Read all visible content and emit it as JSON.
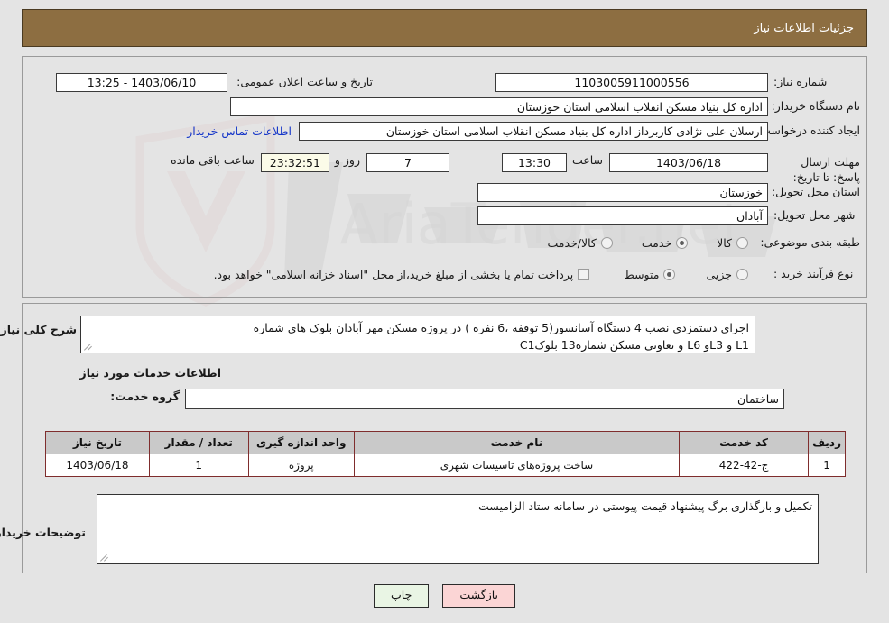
{
  "header": {
    "title": "جزئیات اطلاعات نیاز"
  },
  "colors": {
    "header_bar": "#8d6e41",
    "page_bg": "#e4e4e4",
    "link": "#1435c8",
    "table_header": "#c9c9c9",
    "table_border": "#7f2d2d",
    "print_button": "#e9f5e4",
    "back_button": "#fbd5d5",
    "countdown_field": "#fbfbe8"
  },
  "form": {
    "need_number": {
      "label": "شماره نیاز:",
      "value": "1103005911000556"
    },
    "public_announcement": {
      "label": "تاریخ و ساعت اعلان عمومی:",
      "value": "1403/06/10 - 13:25"
    },
    "buyer_org": {
      "label": "نام دستگاه خریدار:",
      "value": "اداره کل بنیاد مسکن انقلاب اسلامی استان خوزستان"
    },
    "requester": {
      "label": "ایجاد کننده درخواست:",
      "value": "ارسلان علی نژادی کاربرداز اداره کل بنیاد مسکن انقلاب اسلامی استان خوزستان",
      "contact_link": "اطلاعات تماس خریدار"
    },
    "deadline": {
      "label": "مهلت ارسال پاسخ: تا تاریخ:",
      "date": "1403/06/18",
      "time_label": "ساعت",
      "time": "13:30",
      "days": "7",
      "days_label": "روز و",
      "remaining": "23:32:51",
      "remaining_label": "ساعت باقی مانده"
    },
    "delivery_province": {
      "label": "استان محل تحویل:",
      "value": "خوزستان"
    },
    "delivery_city": {
      "label": "شهر محل تحویل:",
      "value": "آبادان"
    },
    "classification": {
      "label": "طبقه بندی موضوعی:",
      "options": [
        {
          "text": "کالا",
          "selected": false
        },
        {
          "text": "خدمت",
          "selected": true
        },
        {
          "text": "کالا/خدمت",
          "selected": false
        }
      ]
    },
    "purchase_type": {
      "label": "نوع فرآیند خرید :",
      "options": [
        {
          "text": "جزیی",
          "selected": false
        },
        {
          "text": "متوسط",
          "selected": true
        }
      ],
      "treasury_note": "پرداخت تمام یا بخشی از مبلغ خرید،از محل \"اسناد خزانه اسلامی\" خواهد بود."
    }
  },
  "need_summary": {
    "label": "شرح کلی نیاز:",
    "line1": "اجرای دستمزدی نصب 4 دستگاه  آسانسور(5 توقفه ،6 نفره ) در  پروژه  مسکن مهر آبادان بلوک های شماره",
    "line2": "L1 و L3و L6 و تعاونی مسکن شماره13 بلوکC1"
  },
  "services_section": {
    "heading": "اطلاعات خدمات مورد نیاز",
    "service_group": {
      "label": "گروه خدمت:",
      "value": "ساختمان"
    }
  },
  "table": {
    "columns": [
      "ردیف",
      "کد خدمت",
      "نام خدمت",
      "واحد اندازه گیری",
      "تعداد / مقدار",
      "تاریخ نیاز"
    ],
    "rows": [
      {
        "radif": "1",
        "code": "ج-42-422",
        "name": "ساخت پروژه‌های تاسیسات شهری",
        "unit": "پروژه",
        "quantity": "1",
        "date": "1403/06/18"
      }
    ]
  },
  "buyer_notes": {
    "label": "توضیحات خریدار:",
    "value": "تکمیل و بارگذاری برگ پیشنهاد قیمت پیوستی در سامانه ستاد الزامیست"
  },
  "buttons": {
    "print": "چاپ",
    "back": "بازگشت"
  }
}
